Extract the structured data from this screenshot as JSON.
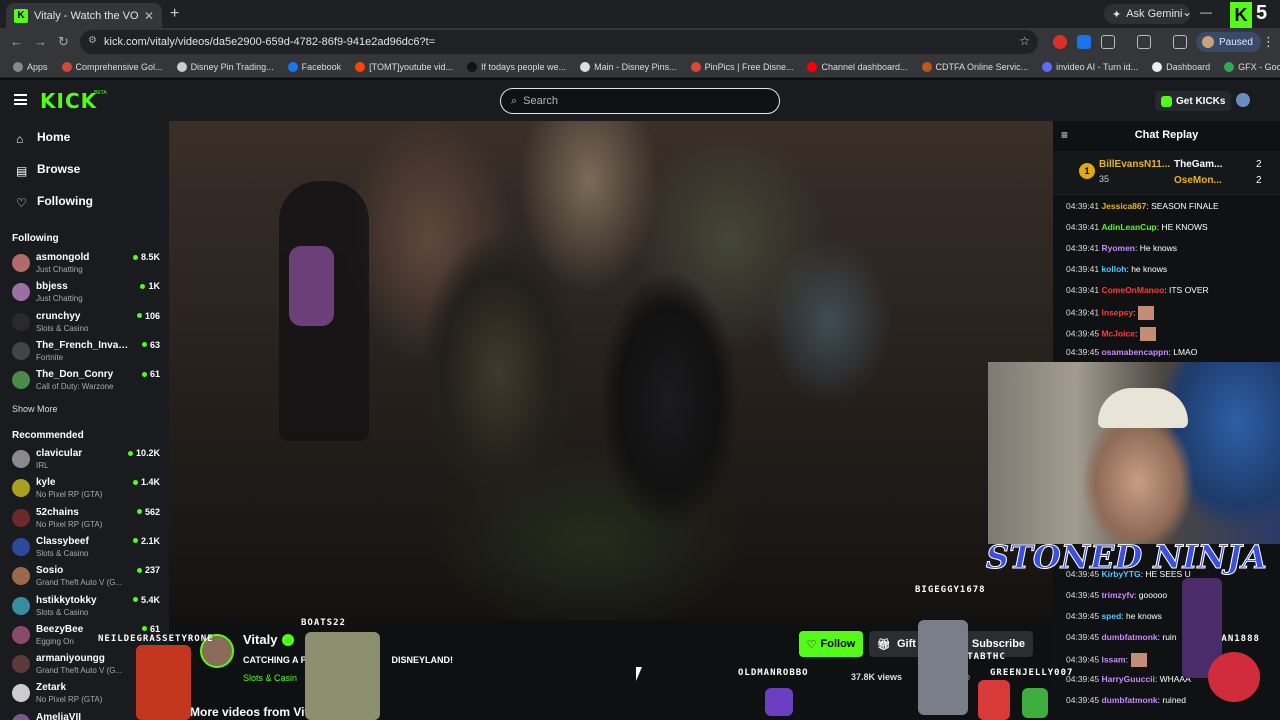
{
  "browser": {
    "tab_title": "Vitaly - Watch the VOD on",
    "tab_close": "✕",
    "new_tab": "+",
    "ask_gemini": "Ask Gemini",
    "url": "kick.com/vitaly/videos/da5e2900-659d-4782-86f9-941e2ad96dc6?t=",
    "profile_status": "Paused",
    "bookmarks": [
      {
        "label": "Apps",
        "color": "#888888"
      },
      {
        "label": "Comprehensive Gol...",
        "color": "#d34836"
      },
      {
        "label": "Disney Pin Trading...",
        "color": "#cccccc"
      },
      {
        "label": "Facebook",
        "color": "#1877f2"
      },
      {
        "label": "[TOMT]youtube vid...",
        "color": "#ff4500"
      },
      {
        "label": "If todays people we...",
        "color": "#111111"
      },
      {
        "label": "Main - Disney Pins...",
        "color": "#dddddd"
      },
      {
        "label": "PinPics | Free Disne...",
        "color": "#e0443a"
      },
      {
        "label": "Channel dashboard...",
        "color": "#ff0000"
      },
      {
        "label": "CDTFA Online Servic...",
        "color": "#c0561b"
      },
      {
        "label": "invideo AI - Turn id...",
        "color": "#5b6cff"
      },
      {
        "label": "Dashboard",
        "color": "#eeeeee"
      },
      {
        "label": "GFX - Google Drive",
        "color": "#34a853"
      }
    ]
  },
  "header": {
    "logo": "KICK",
    "beta": "BETA",
    "search_placeholder": "Search",
    "get_kicks": "Get KICKs"
  },
  "sidebar": {
    "nav": [
      {
        "label": "Home"
      },
      {
        "label": "Browse"
      },
      {
        "label": "Following"
      }
    ],
    "following_title": "Following",
    "following": [
      {
        "name": "asmongold",
        "category": "Just Chatting",
        "viewers": "8.5K",
        "color": "#b06a6a"
      },
      {
        "name": "bbjess",
        "category": "Just Chatting",
        "viewers": "1K",
        "color": "#9a6fa6"
      },
      {
        "name": "crunchyy",
        "category": "Slots & Casino",
        "viewers": "106",
        "color": "#2a2a2a"
      },
      {
        "name": "The_French_Invasi...",
        "category": "Fortnite",
        "viewers": "63",
        "color": "#444444"
      },
      {
        "name": "The_Don_Conry",
        "category": "Call of Duty: Warzone",
        "viewers": "61",
        "color": "#4a8a4a"
      }
    ],
    "show_more": "Show More",
    "recommended_title": "Recommended",
    "recommended": [
      {
        "name": "clavicular",
        "category": "IRL",
        "viewers": "10.2K",
        "color": "#8a8a8a"
      },
      {
        "name": "kyle",
        "category": "No Pixel RP (GTA)",
        "viewers": "1.4K",
        "color": "#a8a020"
      },
      {
        "name": "52chains",
        "category": "No Pixel RP (GTA)",
        "viewers": "562",
        "color": "#6a2a2a"
      },
      {
        "name": "Classybeef",
        "category": "Slots & Casino",
        "viewers": "2.1K",
        "color": "#2a4a9a"
      },
      {
        "name": "Sosio",
        "category": "Grand Theft Auto V (G...",
        "viewers": "237",
        "color": "#9a6a4a"
      },
      {
        "name": "hstikkytokky",
        "category": "Slots & Casino",
        "viewers": "5.4K",
        "color": "#3a8aa0"
      },
      {
        "name": "BeezyBee",
        "category": "Egging On",
        "viewers": "61",
        "color": "#8a4a6a"
      },
      {
        "name": "armaniyoungg",
        "category": "Grand Theft Auto V (G...",
        "viewers": "55",
        "color": "#5a3a3a"
      },
      {
        "name": "Zetark",
        "category": "No Pixel RP (GTA)",
        "viewers": "",
        "color": "#cccccc"
      },
      {
        "name": "AmeliaVII",
        "category": "",
        "viewers": "108",
        "color": "#7a5a8a"
      }
    ]
  },
  "stream": {
    "streamer": "Vitaly",
    "title": "CATCHING A P",
    "title_tail": "DISNEYLAND!",
    "category": "Slots & Casin",
    "follow": "Follow",
    "gift": "Gift Subs",
    "subscribe": "Subscribe",
    "views": "37.8K views",
    "ago": "ago",
    "more_videos": "More videos from Vitaly"
  },
  "chat": {
    "title": "Chat Replay",
    "leaderboard": {
      "rank": "1",
      "first_user": "BillEvansN11...",
      "first_count": "35",
      "second_user": "TheGam...",
      "second_count": "2",
      "third_user": "OseMon...",
      "third_count": "2"
    },
    "messages": [
      {
        "time": "04:39:41",
        "user": "Jessica867",
        "text": ": SEASON FINALE",
        "color": "#e7b416"
      },
      {
        "time": "04:39:41",
        "user": "AdinLeanCup",
        "text": ": HE KNOWS",
        "color": "#53fc18"
      },
      {
        "time": "04:39:41",
        "user": "Ryomen",
        "text": ": He knows",
        "color": "#c68cff"
      },
      {
        "time": "04:39:41",
        "user": "kolloh",
        "text": ": he knows",
        "color": "#53c8ff"
      },
      {
        "time": "04:39:41",
        "user": "ComeOnManoo",
        "text": ": ITS OVER",
        "color": "#ff3b3b"
      },
      {
        "time": "04:39:41",
        "user": "Insepsy",
        "text": ":",
        "color": "#ff3b3b",
        "emote": true
      },
      {
        "time": "04:39:45",
        "user": "McJoice",
        "text": ":",
        "color": "#ff3b3b",
        "emote": true
      },
      {
        "time": "04:39:45",
        "user": "osamabencappn",
        "text": ": LMAO",
        "color": "#c68cff"
      },
      {
        "time": "04:39:45",
        "user": "KirbyYTG",
        "text": ": HE SEES U",
        "color": "#53c8ff"
      },
      {
        "time": "04:39:45",
        "user": "trimzyfv",
        "text": ": gooooo",
        "color": "#c68cff"
      },
      {
        "time": "04:39:45",
        "user": "sped",
        "text": ": he knows",
        "color": "#53c8ff"
      },
      {
        "time": "04:39:45",
        "user": "dumbfatmonk",
        "text": ": ruin",
        "color": "#c68cff"
      },
      {
        "time": "04:39:45",
        "user": "Issam",
        "text": ":",
        "color": "#c68cff",
        "emote": true
      },
      {
        "time": "04:39:45",
        "user": "HarryGuuccii",
        "text": ": WHAAA",
        "color": "#c68cff"
      },
      {
        "time": "04:39:45",
        "user": "dumbfatmonk",
        "text": ": ruined",
        "color": "#c68cff"
      }
    ]
  },
  "overlay": {
    "brand": "STONED NINJA",
    "names": [
      "NEILDEGRASSETYRONE",
      "BOATS22",
      "BIGEGGY1678",
      "OLDMANROBBO",
      "MELTABTHC",
      "GREENJELLY007",
      "MAN1888"
    ]
  },
  "colors": {
    "kick_green": "#53fc18",
    "bg": "#0b0e0f",
    "panel": "#191b1f"
  }
}
